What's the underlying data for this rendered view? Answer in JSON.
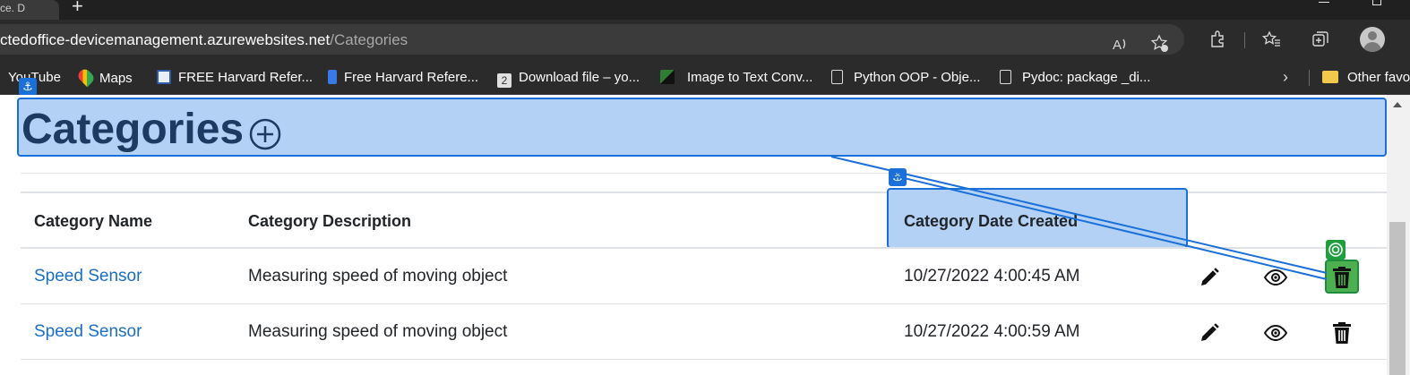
{
  "browser": {
    "active_tab_title": "ce. D",
    "new_tab_glyph": "+",
    "url_host": "ctedoffice-devicemanagement.azurewebsites.net",
    "url_path": "/Categories"
  },
  "bookmarks": [
    {
      "label": "YouTube",
      "icon": "youtube-icon"
    },
    {
      "label": "Maps",
      "icon": "maps-icon"
    },
    {
      "label": "FREE Harvard Refer...",
      "icon": "reference-icon"
    },
    {
      "label": "Free Harvard Refere...",
      "icon": "bookmark-icon"
    },
    {
      "label": "Download file – yo...",
      "icon": "download-icon"
    },
    {
      "label": "Image to Text Conv...",
      "icon": "image-to-text-icon"
    },
    {
      "label": "Python OOP - Obje...",
      "icon": "page-icon"
    },
    {
      "label": "Pydoc: package _di...",
      "icon": "page-icon"
    },
    {
      "label": "Other favo",
      "icon": "folder-icon"
    }
  ],
  "page": {
    "title": "Categories",
    "table": {
      "headers": [
        "Category Name",
        "Category Description",
        "Category Date Created"
      ],
      "rows": [
        {
          "name": "Speed Sensor",
          "description": "Measuring speed of moving object",
          "date": "10/27/2022 4:00:45 AM"
        },
        {
          "name": "Speed Sensor",
          "description": "Measuring speed of moving object",
          "date": "10/27/2022 4:00:59 AM"
        }
      ]
    }
  },
  "colors": {
    "highlight_fill": "#b3d1f5",
    "highlight_border": "#1a6fd8",
    "target_green": "#4caf50",
    "link": "#1a6fc4",
    "title": "#1c3b63"
  }
}
